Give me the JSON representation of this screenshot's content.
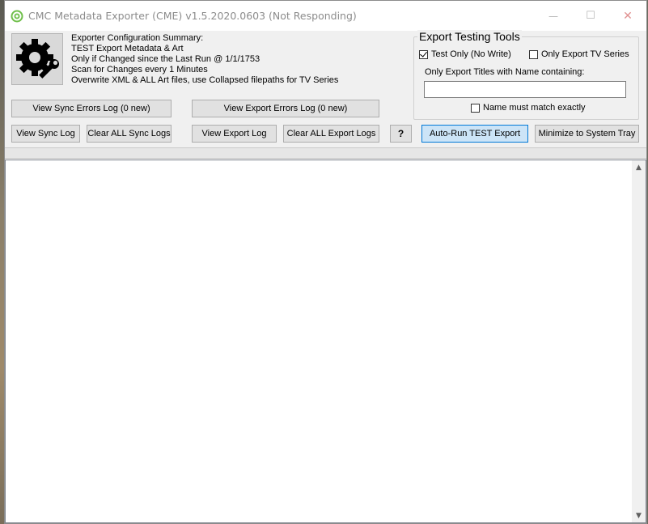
{
  "window": {
    "title": "CMC Metadata Exporter (CME) v1.5.2020.0603 (Not Responding)",
    "minimize_glyph": "—",
    "maximize_glyph": "☐",
    "close_glyph": "✕"
  },
  "summary": {
    "heading": "Exporter Configuration Summary:",
    "lines": [
      "TEST Export Metadata & Art",
      "Only if Changed since the Last Run @ 1/1/1753",
      "Scan for Changes every 1 Minutes",
      "Overwrite XML & ALL Art files, use Collapsed filepaths for TV Series"
    ]
  },
  "testing_tools": {
    "title": "Export Testing Tools",
    "test_only_label": "Test Only (No Write)",
    "test_only_checked": true,
    "tv_series_label": "Only Export TV Series",
    "tv_series_checked": false,
    "name_filter_label": "Only Export Titles with Name containing:",
    "name_filter_value": "",
    "exact_match_label": "Name must match exactly",
    "exact_match_checked": false
  },
  "buttons": {
    "view_sync_errors": "View Sync Errors Log (0 new)",
    "view_export_errors": "View Export Errors Log (0 new)",
    "view_sync_log": "View Sync Log",
    "clear_sync_logs": "Clear ALL Sync Logs",
    "view_export_log": "View Export Log",
    "clear_export_logs": "Clear ALL Export Logs",
    "help": "?",
    "auto_run": "Auto-Run TEST Export",
    "minimize_tray": "Minimize to System Tray"
  },
  "log": {
    "content": ""
  },
  "colors": {
    "accent_button": "#cce4f7",
    "accent_border": "#0078d7",
    "app_icon": "#6fbf4a"
  },
  "icons": {
    "app": "cmc-leaf-icon",
    "settings": "gear-wrench-icon"
  }
}
